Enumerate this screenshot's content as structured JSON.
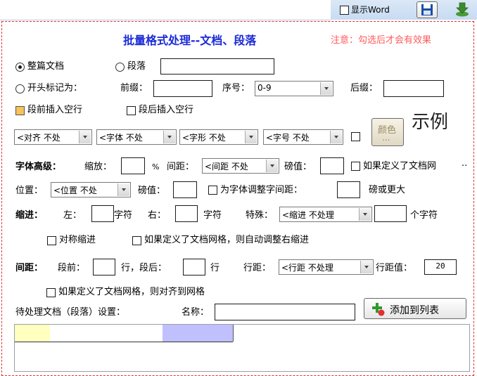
{
  "toolbar": {
    "show_word_label": "显示Word"
  },
  "header": {
    "title": "批量格式处理--文档、段落",
    "note": "注意：勾选后才会有效果"
  },
  "scope": {
    "whole_doc_label": "整篇文档",
    "paragraph_label": "段落",
    "prefix_mark_label": "开头标记为：",
    "prefix_label": "前缀：",
    "seq_label": "序号：",
    "seq_value": "0-9",
    "suffix_label": "后缀："
  },
  "blank_lines": {
    "before_label": "段前插入空行",
    "after_label": "段后插入空行"
  },
  "combos": {
    "align": "<对齐 不处",
    "font": "<字体 不处",
    "shape": "<字形 不处",
    "size": "<字号 不处"
  },
  "color_button": {
    "label": "颜色",
    "sub": "..."
  },
  "preview": {
    "label": "示例"
  },
  "font_adv": {
    "heading": "字体高级：",
    "scale_label": "缩放：",
    "percent_label": "%",
    "spacing_label": "间距：",
    "spacing_combo": "<间距 不处",
    "pt_label": "磅值：",
    "grid_label": "如果定义了文档网"
  },
  "position": {
    "label": "位置：",
    "combo": "<位置 不处",
    "pt_label": "磅值：",
    "kern_label": "为字体调整字间距：",
    "kern_suffix": "磅或更大"
  },
  "indent": {
    "heading": "缩进：",
    "left_label": "左：",
    "char_label_1": "字符",
    "right_label": "右：",
    "char_label_2": "字符",
    "special_label": "特殊：",
    "special_combo": "<缩进 不处理",
    "chars_label": "个字符",
    "symmetric_label": "对称缩进",
    "auto_right_label": "如果定义了文档网格，则自动调整右缩进"
  },
  "spacing": {
    "heading": "间距：",
    "before_label": "段前：",
    "row_after_before": "行，段后：",
    "row_label": "行",
    "line_label": "行距：",
    "line_combo": "<行距 不处理",
    "line_value_label": "行距值：",
    "line_value": "20",
    "grid_align_label": "如果定义了文档网格，则对齐到网格"
  },
  "pending": {
    "label": "待处理文档（段落）设置：",
    "name_label": "名称：",
    "add_button": "添加到列表"
  },
  "colors": {
    "title": "#1a2ad8",
    "note": "#ff5a5a",
    "checked": "#f7c35a",
    "grid_cell_yellow": "#ffffc0",
    "grid_cell_blue": "#c0c0ff"
  }
}
